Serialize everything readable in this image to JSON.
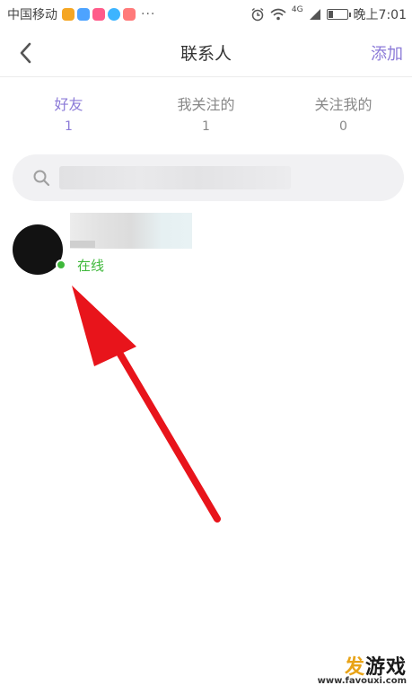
{
  "status_bar": {
    "carrier": "中国移动",
    "more": "···",
    "network": "4G",
    "time": "晚上7:01",
    "app_icons": [
      "#f5a623",
      "#4da3ff",
      "#ff5b8a",
      "#3db4ff",
      "#ff7a7a"
    ]
  },
  "header": {
    "back_icon": "chevron-left-icon",
    "title": "联系人",
    "add_label": "添加"
  },
  "tabs": [
    {
      "label": "好友",
      "count": "1",
      "active": true
    },
    {
      "label": "我关注的",
      "count": "1",
      "active": false
    },
    {
      "label": "关注我的",
      "count": "0",
      "active": false
    }
  ],
  "search": {
    "icon": "search-icon"
  },
  "contacts": [
    {
      "status": "在线",
      "online": true
    }
  ],
  "watermark": {
    "brand_accent": "发",
    "brand_rest": "游戏",
    "url": "www.favouxi.com"
  },
  "colors": {
    "accent": "#8c7bd8",
    "online": "#3fb83b",
    "arrow": "#e8141b"
  }
}
